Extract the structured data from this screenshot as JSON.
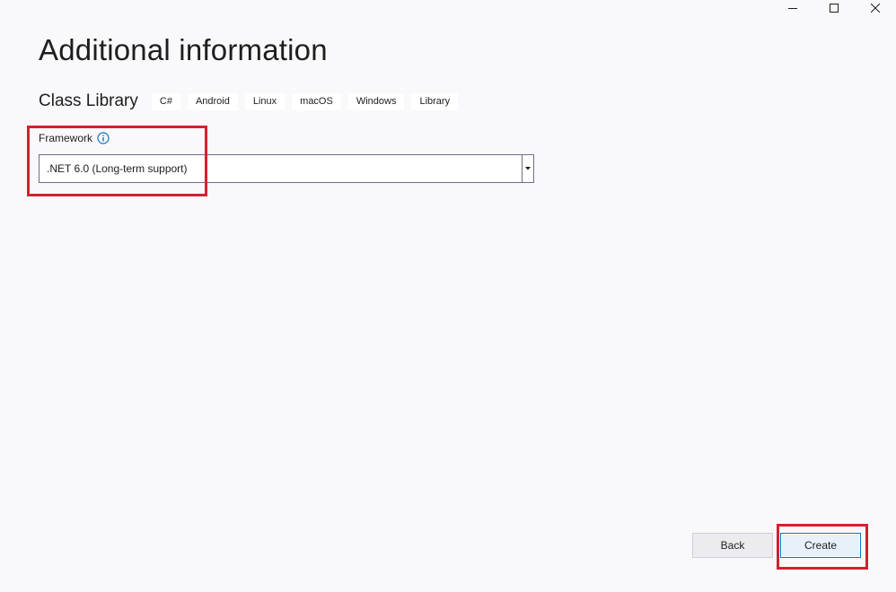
{
  "window": {
    "controls": {
      "minimize_icon": "minimize-icon",
      "maximize_icon": "maximize-icon",
      "close_icon": "close-icon"
    }
  },
  "page": {
    "title": "Additional information"
  },
  "template": {
    "name": "Class Library",
    "tags": [
      "C#",
      "Android",
      "Linux",
      "macOS",
      "Windows",
      "Library"
    ]
  },
  "framework": {
    "label": "Framework",
    "info_icon": "info-icon",
    "selected_value": ".NET 6.0 (Long-term support)",
    "dropdown_icon": "dropdown-arrow-icon"
  },
  "footer": {
    "back_label": "Back",
    "create_label": "Create"
  },
  "colors": {
    "background": "#F9F9FB",
    "highlight": "#D32030",
    "info_accent": "#0E70C0",
    "primary_border": "#007ACC"
  }
}
